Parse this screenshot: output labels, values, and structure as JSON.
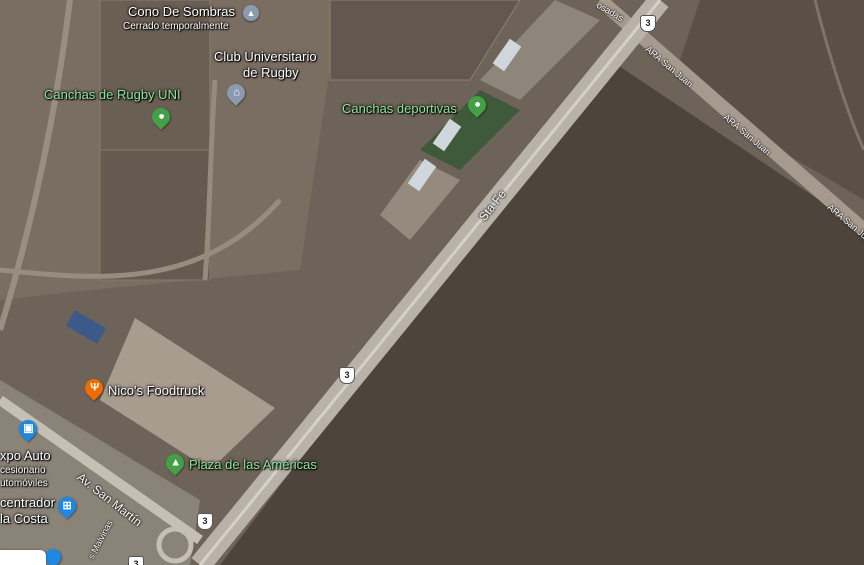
{
  "colors": {
    "green_pin": "#43a047",
    "orange_pin": "#ef6c00",
    "blue_pin": "#1e88e5",
    "grey_pin": "#8a9bb0"
  },
  "places": {
    "cono_de_sombras": {
      "name": "Cono De Sombras",
      "status": "Cerrado temporalmente",
      "icon": "landmark-icon"
    },
    "club_universitario": {
      "name_line1": "Club Universitario",
      "name_line2": "de Rugby",
      "icon": "school-icon"
    },
    "canchas_rugby_uni": {
      "name": "Canchas de Rugby UNI",
      "icon": "park-pin-icon"
    },
    "canchas_deportivas": {
      "name": "Canchas deportivas",
      "icon": "park-pin-icon"
    },
    "nicos_foodtruck": {
      "name": "Nico's Foodtruck",
      "icon": "restaurant-icon"
    },
    "plaza_americas": {
      "name": "Plaza de las Américas",
      "icon": "tree-icon"
    },
    "expo_auto": {
      "name": "xpo Auto",
      "sub_line1": "cesionario",
      "sub_line2": "utomóviles",
      "icon": "shopping-bag-icon"
    },
    "centrador": {
      "name_line1": "centrador",
      "name_line2": "la Costa",
      "icon": "shopping-cart-icon"
    }
  },
  "roads": {
    "sta_fe": "Sta Fe",
    "ara_san_juan": "ARA San Juan",
    "av_san_martin": "Av. San Martín",
    "malvinas": "s Malvinas",
    "posadas": "osadas",
    "route_number": "3"
  }
}
